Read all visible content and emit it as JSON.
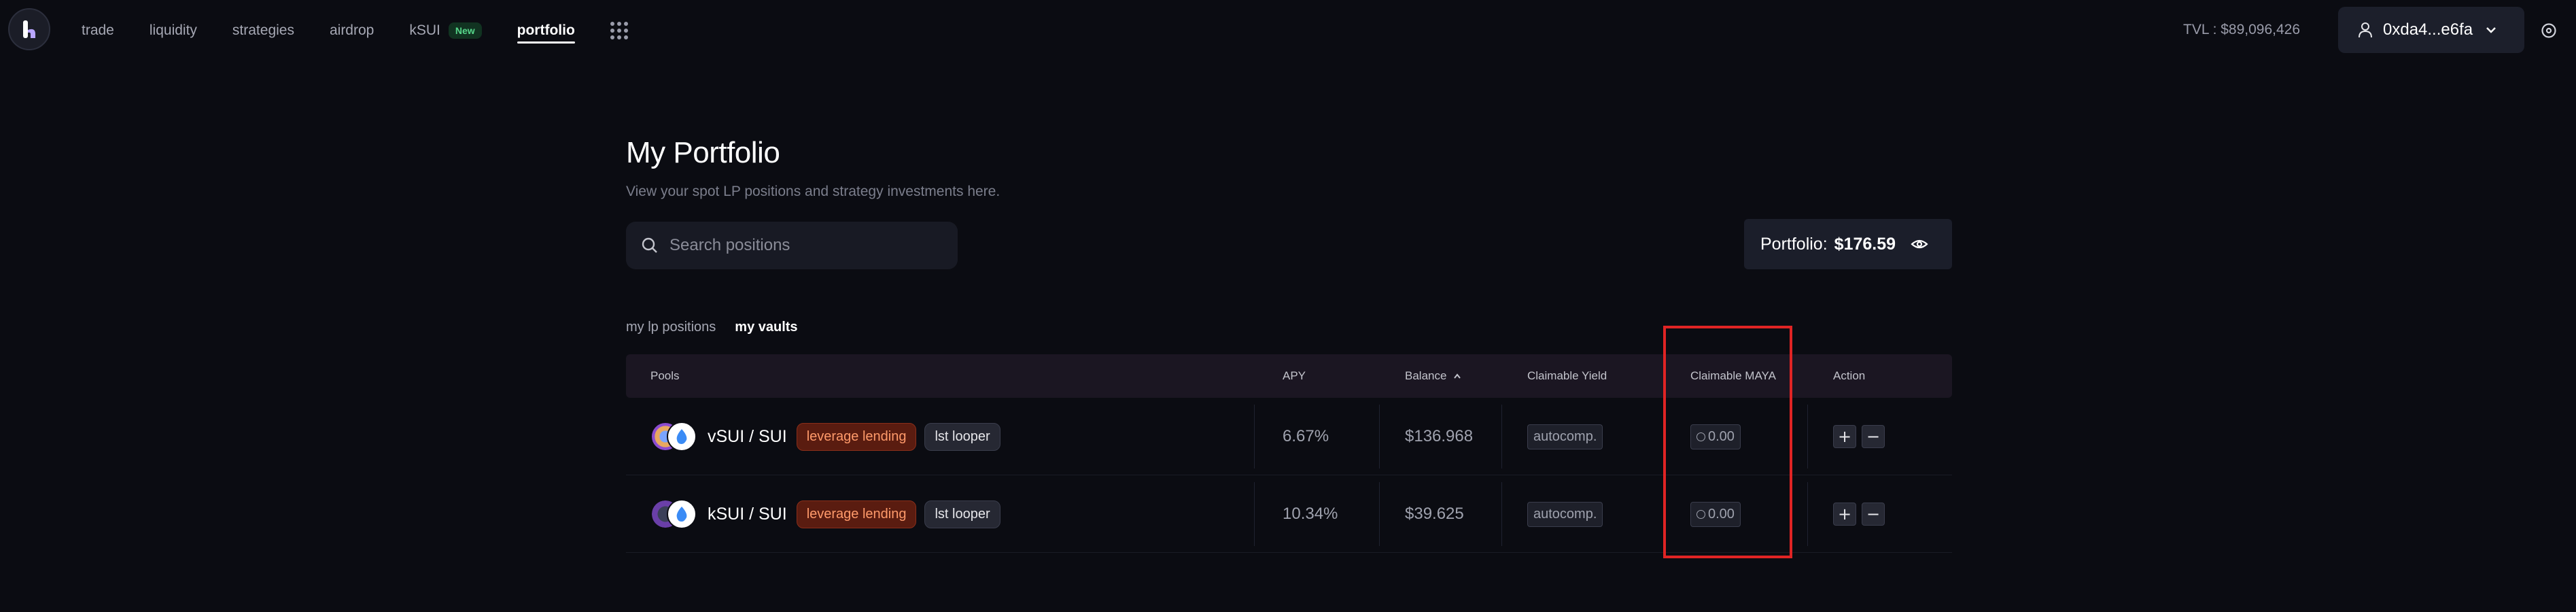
{
  "nav": {
    "items": [
      {
        "label": "trade"
      },
      {
        "label": "liquidity"
      },
      {
        "label": "strategies"
      },
      {
        "label": "airdrop"
      },
      {
        "label": "kSUI",
        "badge": "New"
      },
      {
        "label": "portfolio",
        "active": true
      }
    ],
    "tvl": "TVL : $89,096,426",
    "wallet_address": "0xda4...e6fa"
  },
  "page": {
    "title": "My Portfolio",
    "subtitle": "View your spot LP positions and strategy investments here.",
    "search_placeholder": "Search positions",
    "portfolio_label": "Portfolio:",
    "portfolio_value": "$176.59"
  },
  "tabs": [
    {
      "label": "my lp positions",
      "active": false
    },
    {
      "label": "my vaults",
      "active": true
    }
  ],
  "table": {
    "columns": {
      "pools": "Pools",
      "apy": "APY",
      "balance": "Balance",
      "claimable_yield": "Claimable Yield",
      "claimable_maya": "Claimable MAYA",
      "action": "Action"
    },
    "rows": [
      {
        "pair": "vSUI / SUI",
        "tag1": "leverage lending",
        "tag2": "lst looper",
        "apy": "6.67%",
        "balance": "$136.968",
        "claimable_yield": "autocomp.",
        "claimable_maya": "0.00"
      },
      {
        "pair": "kSUI / SUI",
        "tag1": "leverage lending",
        "tag2": "lst looper",
        "apy": "10.34%",
        "balance": "$39.625",
        "claimable_yield": "autocomp.",
        "claimable_maya": "0.00"
      }
    ],
    "action_add": "+",
    "action_remove": "−"
  },
  "colors": {
    "background": "#0b0c12",
    "highlight": "#e02424",
    "leverage_tag": "#ff9a6a"
  }
}
